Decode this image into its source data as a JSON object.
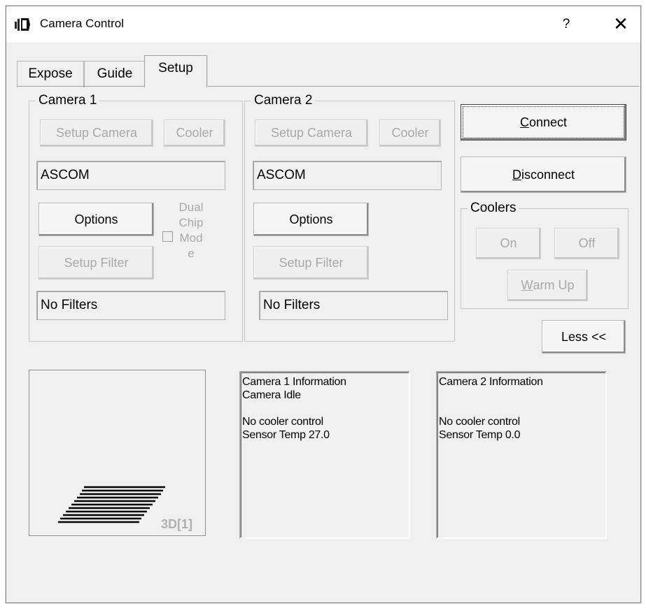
{
  "window": {
    "title": "Camera Control",
    "help_label": "?",
    "close_label": "✕"
  },
  "tabs": [
    {
      "label": "Expose",
      "active": false
    },
    {
      "label": "Guide",
      "active": false
    },
    {
      "label": "Setup",
      "active": true
    }
  ],
  "camera1": {
    "group_label": "Camera 1",
    "setup_camera_label": "Setup Camera",
    "cooler_label": "Cooler",
    "driver_value": "ASCOM",
    "options_label": "Options",
    "setup_filter_label": "Setup Filter",
    "filter_value": "No Filters",
    "dual_chip_lines": [
      "Dual",
      "Chip",
      "Mod",
      "e"
    ],
    "dual_chip_checked": false
  },
  "camera2": {
    "group_label": "Camera 2",
    "setup_camera_label": "Setup Camera",
    "cooler_label": "Cooler",
    "driver_value": "ASCOM",
    "options_label": "Options",
    "setup_filter_label": "Setup Filter",
    "filter_value": "No Filters"
  },
  "actions": {
    "connect": {
      "mnemonic": "C",
      "rest": "onnect"
    },
    "disconnect": {
      "mnemonic": "D",
      "rest": "isconnect"
    },
    "less_label": "Less <<"
  },
  "coolers": {
    "group_label": "Coolers",
    "on_label": "On",
    "off_label": "Off",
    "warm_up": {
      "mnemonic": "W",
      "rest": "arm Up"
    }
  },
  "preview": {
    "label": "3D[1]"
  },
  "info": {
    "camera1_text": "Camera 1 Information\nCamera Idle\n\nNo cooler control\nSensor Temp 27.0",
    "camera2_text": "Camera 2 Information\n\n\nNo cooler control\nSensor Temp 0.0"
  },
  "colors": {
    "window_bg": "#f0f0f0",
    "disabled_text": "#a8a8a8",
    "border": "#adadad"
  },
  "icons": [
    "app-icon",
    "help-icon",
    "close-icon",
    "preview-stack-icon"
  ]
}
